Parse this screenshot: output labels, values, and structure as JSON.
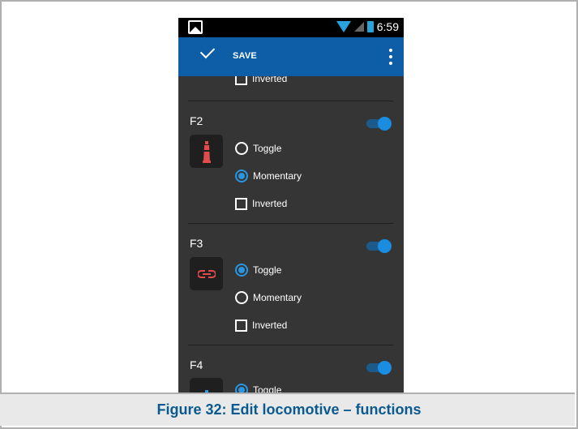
{
  "statusbar": {
    "time": "6:59"
  },
  "appbar": {
    "save_label": "SAVE"
  },
  "functions": [
    {
      "label": "F2",
      "icon": "lighthouse-icon",
      "options": {
        "toggle": "Toggle",
        "momentary": "Momentary",
        "inverted": "Inverted"
      },
      "selected": "Momentary",
      "enabled": true
    },
    {
      "label": "F3",
      "icon": "coupler-icon",
      "options": {
        "toggle": "Toggle",
        "momentary": "Momentary",
        "inverted": "Inverted"
      },
      "selected": "Toggle",
      "enabled": true
    },
    {
      "label": "F4",
      "icon": "bell-icon",
      "options": {
        "toggle": "Toggle"
      },
      "selected": "Toggle",
      "enabled": true
    }
  ],
  "partial_top": {
    "inverted_label": "Inverted"
  },
  "caption": "Figure 32: Edit locomotive – functions",
  "colors": {
    "appbar": "#0d5ea6",
    "accent": "#2a95e0",
    "icon_red": "#e04b4b",
    "icon_blue": "#2a95e0",
    "caption": "#0b5a8f"
  }
}
